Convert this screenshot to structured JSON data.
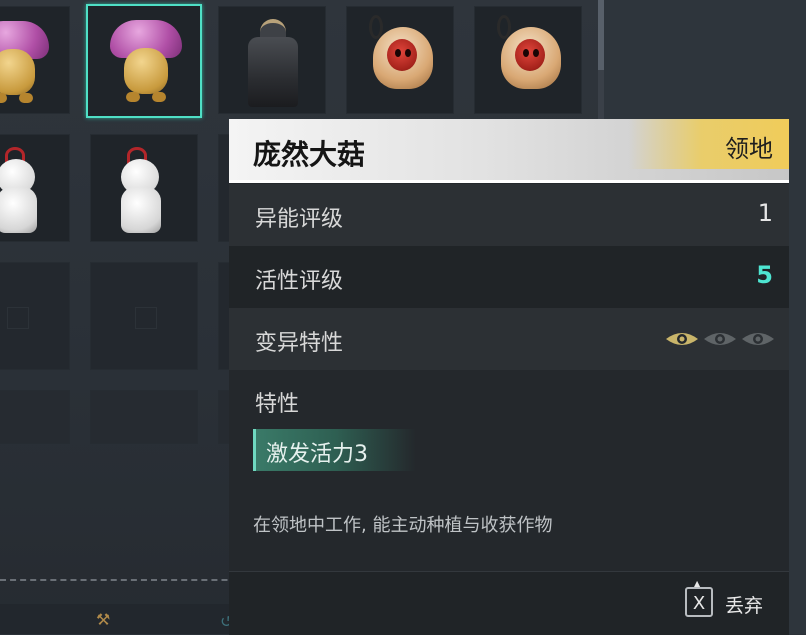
{
  "panel": {
    "title": "庞然大菇",
    "tag": "领地",
    "rows": [
      {
        "label": "异能评级",
        "value": "1"
      },
      {
        "label": "活性评级",
        "value": "5"
      },
      {
        "label": "变异特性"
      }
    ],
    "mutation_eyes": {
      "active": 1,
      "total": 3,
      "active_color": "#c9b56a",
      "inactive_color": "#6a6e70"
    },
    "trait_heading": "特性",
    "trait": "激发活力3",
    "description": "在领地中工作, 能主动种植与收获作物",
    "footer": {
      "key": "X",
      "action": "丢弃"
    }
  },
  "inventory": {
    "slots": [
      {
        "icon": "mushroom-creature-icon"
      },
      {
        "icon": "mushroom-creature-icon",
        "selected": true
      },
      {
        "icon": "samurai-armor-icon"
      },
      {
        "icon": "red-mask-creature-icon"
      },
      {
        "icon": "red-mask-creature-icon"
      },
      {
        "icon": "white-doll-icon"
      },
      {
        "icon": "white-doll-icon"
      }
    ]
  },
  "colors": {
    "accent_teal": "#4ee6d2",
    "selection_border": "#4fe0c6",
    "header_gold": "#f0cc5a"
  }
}
